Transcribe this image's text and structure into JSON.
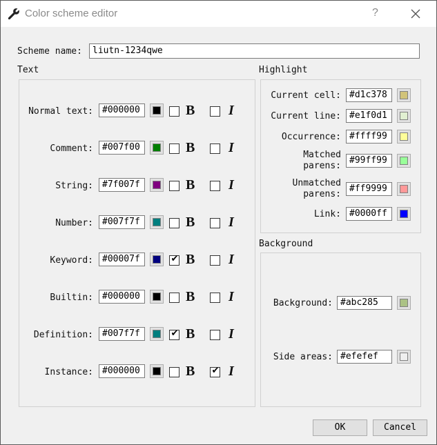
{
  "window": {
    "title": "Color scheme editor",
    "help": "?",
    "ok_label": "OK",
    "cancel_label": "Cancel"
  },
  "scheme": {
    "label": "Scheme name:",
    "value": "liutn-1234qwe"
  },
  "text_group": {
    "label": "Text",
    "bold_glyph": "B",
    "italic_glyph": "I",
    "rows": [
      {
        "label": "Normal text:",
        "value": "#000000",
        "color": "#000000",
        "bold": false,
        "italic": false
      },
      {
        "label": "Comment:",
        "value": "#007f00",
        "color": "#007f00",
        "bold": false,
        "italic": false
      },
      {
        "label": "String:",
        "value": "#7f007f",
        "color": "#7f007f",
        "bold": false,
        "italic": false
      },
      {
        "label": "Number:",
        "value": "#007f7f",
        "color": "#007f7f",
        "bold": false,
        "italic": false
      },
      {
        "label": "Keyword:",
        "value": "#00007f",
        "color": "#00007f",
        "bold": true,
        "italic": false
      },
      {
        "label": "Builtin:",
        "value": "#000000",
        "color": "#000000",
        "bold": false,
        "italic": false
      },
      {
        "label": "Definition:",
        "value": "#007f7f",
        "color": "#007f7f",
        "bold": true,
        "italic": false
      },
      {
        "label": "Instance:",
        "value": "#000000",
        "color": "#000000",
        "bold": false,
        "italic": true
      }
    ]
  },
  "highlight_group": {
    "label": "Highlight",
    "rows": [
      {
        "label": "Current cell:",
        "value": "#d1c378",
        "color": "#d1c378"
      },
      {
        "label": "Current line:",
        "value": "#e1f0d1",
        "color": "#e1f0d1"
      },
      {
        "label": "Occurrence:",
        "value": "#ffff99",
        "color": "#ffff99"
      },
      {
        "label_line1": "Matched",
        "label_line2": "parens:",
        "value": "#99ff99",
        "color": "#99ff99"
      },
      {
        "label_line1": "Unmatched",
        "label_line2": "parens:",
        "value": "#ff9999",
        "color": "#ff9999"
      },
      {
        "label": "Link:",
        "value": "#0000ff",
        "color": "#0000ff"
      }
    ]
  },
  "background_group": {
    "label": "Background",
    "rows": [
      {
        "label": "Background:",
        "value": "#abc285",
        "color": "#abc285"
      },
      {
        "label": "Side areas:",
        "value": "#efefef",
        "color": "#efefef"
      }
    ]
  },
  "colors": {
    "chrome": "#f0f0f0",
    "titlebar": "#ffffff",
    "button_face": "#e1e1e1"
  }
}
